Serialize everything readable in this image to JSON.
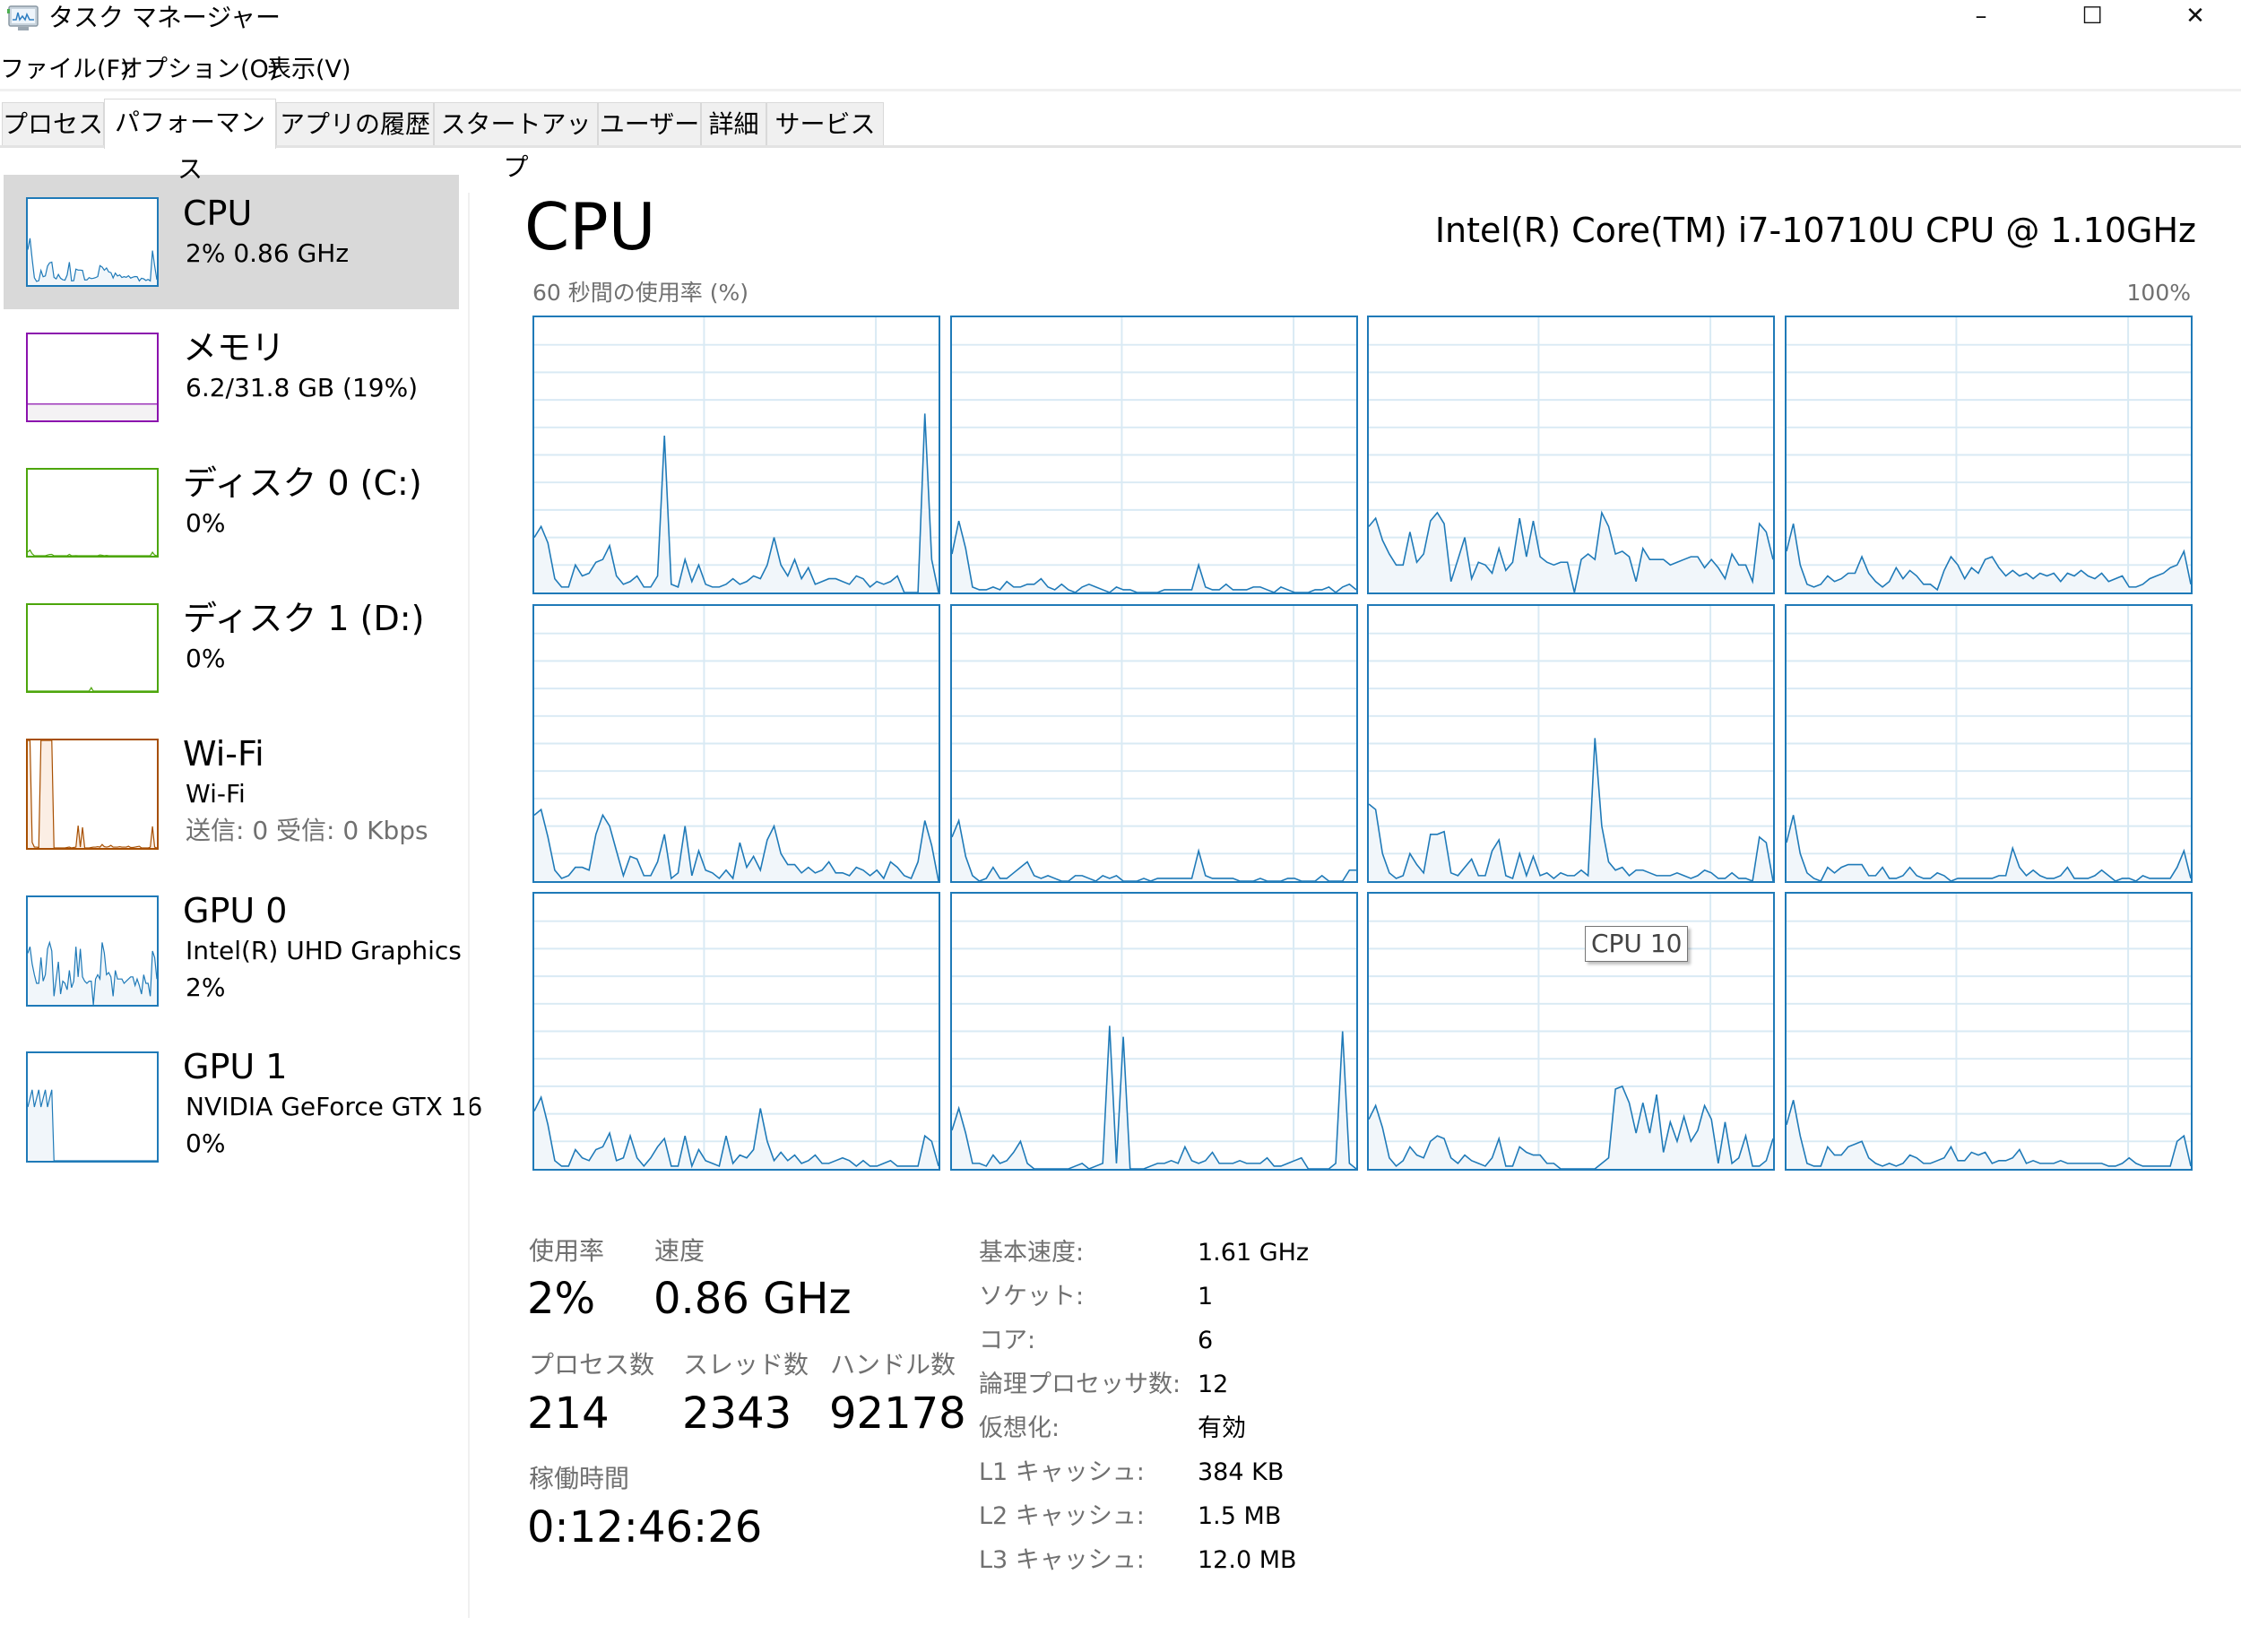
{
  "window": {
    "title": "タスク マネージャー",
    "icon": "task-manager-icon",
    "controls": {
      "minimize": "–",
      "maximize": "☐",
      "close": "✕"
    }
  },
  "menu": [
    "ファイル(F)",
    "オプション(O)",
    "表示(V)"
  ],
  "tabs": [
    {
      "label": "プロセス",
      "active": false
    },
    {
      "label": "パフォーマンス",
      "active": true
    },
    {
      "label": "アプリの履歴",
      "active": false
    },
    {
      "label": "スタートアップ",
      "active": false
    },
    {
      "label": "ユーザー",
      "active": false
    },
    {
      "label": "詳細",
      "active": false
    },
    {
      "label": "サービス",
      "active": false
    }
  ],
  "sidebar": {
    "items": [
      {
        "title": "CPU",
        "line1": "2%  0.86 GHz",
        "line2": "",
        "selected": true,
        "color": "#1f7ab8"
      },
      {
        "title": "メモリ",
        "line1": "6.2/31.8 GB (19%)",
        "line2": "",
        "selected": false,
        "color": "#8b12ae"
      },
      {
        "title": "ディスク 0 (C:)",
        "line1": "0%",
        "line2": "",
        "selected": false,
        "color": "#4da60c"
      },
      {
        "title": "ディスク 1 (D:)",
        "line1": "0%",
        "line2": "",
        "selected": false,
        "color": "#4da60c"
      },
      {
        "title": "Wi-Fi",
        "line1": "Wi-Fi",
        "line2": "送信: 0  受信: 0 Kbps",
        "selected": false,
        "color": "#a74f01"
      },
      {
        "title": "GPU 0",
        "line1": "Intel(R) UHD Graphics",
        "line2": "2%",
        "selected": false,
        "color": "#1f7ab8"
      },
      {
        "title": "GPU 1",
        "line1": "NVIDIA GeForce GTX 16",
        "line2": "0%",
        "selected": false,
        "color": "#1f7ab8"
      }
    ]
  },
  "main": {
    "title": "CPU",
    "model": "Intel(R) Core(TM) i7-10710U CPU @ 1.10GHz",
    "graph_label": "60 秒間の使用率 (%)",
    "graph_max": "100%",
    "tooltip": "CPU 10",
    "stats": {
      "usage_label": "使用率",
      "usage_value": "2%",
      "speed_label": "速度",
      "speed_value": "0.86 GHz",
      "processes_label": "プロセス数",
      "processes_value": "214",
      "threads_label": "スレッド数",
      "threads_value": "2343",
      "handles_label": "ハンドル数",
      "handles_value": "92178",
      "uptime_label": "稼働時間",
      "uptime_value": "0:12:46:26"
    },
    "info": [
      {
        "label": "基本速度:",
        "value": "1.61 GHz"
      },
      {
        "label": "ソケット:",
        "value": "1"
      },
      {
        "label": "コア:",
        "value": "6"
      },
      {
        "label": "論理プロセッサ数:",
        "value": "12"
      },
      {
        "label": "仮想化:",
        "value": "有効"
      },
      {
        "label": "L1 キャッシュ:",
        "value": "384 KB"
      },
      {
        "label": "L2 キャッシュ:",
        "value": "1.5 MB"
      },
      {
        "label": "L3 キャッシュ:",
        "value": "12.0 MB"
      }
    ]
  },
  "chart_data": {
    "type": "area",
    "title": "60 秒間の使用率 (%)",
    "ylim": [
      0,
      100
    ],
    "xlim": [
      0,
      60
    ],
    "grid": true,
    "line_color": "#1f7ab8",
    "fill_color": "#f1f6fa",
    "series": [
      {
        "name": "CPU 0",
        "values": [
          20,
          24,
          18,
          5,
          2,
          2,
          10,
          6,
          7,
          11,
          12,
          17,
          6,
          3,
          4,
          6,
          2,
          2,
          6,
          57,
          3,
          2,
          12,
          4,
          10,
          3,
          2,
          2,
          3,
          5,
          3,
          4,
          6,
          5,
          10,
          20,
          10,
          6,
          12,
          5,
          9,
          3,
          4,
          5,
          5,
          4,
          3,
          6,
          5,
          2,
          4,
          3,
          4,
          6,
          0,
          0,
          0,
          65,
          12,
          0
        ]
      },
      {
        "name": "CPU 1",
        "values": [
          14,
          26,
          16,
          2,
          1,
          1,
          2,
          1,
          4,
          2,
          2,
          3,
          3,
          5,
          2,
          1,
          3,
          1,
          0,
          2,
          3,
          2,
          1,
          0,
          2,
          1,
          1,
          0,
          0,
          0,
          0,
          1,
          1,
          1,
          1,
          1,
          10,
          2,
          1,
          1,
          3,
          1,
          1,
          1,
          2,
          2,
          1,
          0,
          2,
          1,
          0,
          0,
          0,
          1,
          1,
          2,
          0,
          2,
          3,
          1
        ]
      },
      {
        "name": "CPU 2",
        "values": [
          24,
          27,
          19,
          14,
          10,
          10,
          22,
          11,
          14,
          26,
          29,
          25,
          4,
          12,
          20,
          5,
          11,
          10,
          7,
          16,
          8,
          11,
          27,
          13,
          26,
          13,
          11,
          10,
          11,
          11,
          0,
          12,
          14,
          12,
          29,
          24,
          14,
          15,
          13,
          4,
          16,
          12,
          12,
          12,
          10,
          11,
          12,
          13,
          13,
          9,
          12,
          9,
          5,
          14,
          10,
          10,
          4,
          25,
          22,
          12
        ]
      },
      {
        "name": "CPU 3",
        "values": [
          15,
          25,
          10,
          3,
          2,
          3,
          6,
          4,
          5,
          7,
          7,
          13,
          7,
          4,
          2,
          4,
          9,
          5,
          8,
          6,
          3,
          3,
          1,
          8,
          13,
          10,
          5,
          9,
          7,
          12,
          13,
          9,
          6,
          8,
          6,
          7,
          5,
          7,
          6,
          7,
          4,
          7,
          6,
          8,
          6,
          5,
          7,
          4,
          5,
          6,
          2,
          2,
          3,
          5,
          6,
          7,
          9,
          10,
          15,
          3
        ]
      },
      {
        "name": "CPU 4",
        "values": [
          24,
          26,
          16,
          4,
          1,
          2,
          5,
          5,
          4,
          17,
          24,
          20,
          11,
          2,
          9,
          8,
          2,
          2,
          7,
          17,
          1,
          3,
          20,
          2,
          11,
          4,
          3,
          1,
          4,
          1,
          14,
          5,
          9,
          4,
          15,
          20,
          10,
          6,
          6,
          3,
          5,
          3,
          4,
          7,
          3,
          3,
          2,
          5,
          4,
          2,
          4,
          1,
          7,
          5,
          2,
          1,
          7,
          22,
          13,
          0
        ]
      },
      {
        "name": "CPU 5",
        "values": [
          16,
          22,
          9,
          2,
          0,
          1,
          5,
          1,
          1,
          3,
          5,
          7,
          2,
          1,
          2,
          1,
          0,
          0,
          2,
          2,
          1,
          0,
          2,
          1,
          2,
          0,
          0,
          0,
          1,
          0,
          1,
          1,
          1,
          1,
          1,
          1,
          11,
          2,
          1,
          1,
          1,
          1,
          0,
          0,
          0,
          1,
          0,
          0,
          0,
          1,
          1,
          0,
          0,
          0,
          2,
          0,
          0,
          0,
          4,
          4
        ]
      },
      {
        "name": "CPU 6",
        "values": [
          28,
          26,
          10,
          3,
          1,
          2,
          10,
          6,
          3,
          17,
          17,
          18,
          3,
          2,
          5,
          8,
          2,
          2,
          11,
          15,
          2,
          1,
          10,
          2,
          9,
          2,
          3,
          1,
          3,
          2,
          2,
          4,
          2,
          52,
          20,
          7,
          4,
          5,
          2,
          4,
          4,
          3,
          2,
          2,
          2,
          3,
          2,
          1,
          2,
          4,
          3,
          1,
          1,
          3,
          1,
          1,
          0,
          16,
          14,
          0
        ]
      },
      {
        "name": "CPU 7",
        "values": [
          14,
          24,
          10,
          3,
          1,
          0,
          5,
          3,
          5,
          6,
          6,
          6,
          2,
          2,
          5,
          1,
          1,
          2,
          5,
          2,
          1,
          1,
          3,
          2,
          0,
          1,
          1,
          1,
          1,
          1,
          1,
          2,
          2,
          12,
          5,
          2,
          4,
          2,
          1,
          1,
          2,
          5,
          1,
          1,
          1,
          2,
          4,
          2,
          0,
          1,
          1,
          0,
          2,
          1,
          1,
          1,
          1,
          5,
          11,
          1
        ]
      },
      {
        "name": "CPU 8",
        "values": [
          21,
          26,
          16,
          3,
          1,
          1,
          7,
          4,
          3,
          7,
          8,
          13,
          3,
          4,
          12,
          4,
          1,
          4,
          8,
          11,
          1,
          1,
          12,
          1,
          7,
          3,
          2,
          1,
          12,
          2,
          5,
          4,
          7,
          22,
          10,
          3,
          6,
          3,
          5,
          2,
          3,
          5,
          2,
          2,
          3,
          4,
          3,
          1,
          3,
          1,
          1,
          2,
          3,
          1,
          1,
          1,
          1,
          12,
          10,
          1
        ]
      },
      {
        "name": "CPU 9",
        "values": [
          14,
          22,
          13,
          2,
          2,
          1,
          5,
          2,
          3,
          6,
          10,
          2,
          0,
          0,
          0,
          0,
          0,
          0,
          1,
          2,
          0,
          1,
          2,
          52,
          2,
          48,
          0,
          0,
          0,
          1,
          2,
          2,
          3,
          2,
          8,
          3,
          2,
          3,
          6,
          2,
          2,
          2,
          3,
          2,
          2,
          2,
          4,
          1,
          1,
          2,
          3,
          4,
          0,
          0,
          0,
          0,
          2,
          50,
          2,
          0
        ]
      },
      {
        "name": "CPU 10",
        "values": [
          18,
          23,
          15,
          4,
          1,
          3,
          8,
          5,
          4,
          10,
          12,
          11,
          4,
          2,
          5,
          3,
          2,
          1,
          4,
          11,
          1,
          1,
          8,
          6,
          5,
          5,
          2,
          2,
          0,
          0,
          0,
          0,
          0,
          0,
          2,
          4,
          29,
          30,
          24,
          13,
          24,
          13,
          27,
          6,
          17,
          10,
          19,
          10,
          14,
          23,
          18,
          2,
          17,
          2,
          4,
          12,
          1,
          1,
          3,
          11
        ]
      },
      {
        "name": "CPU 11",
        "values": [
          16,
          25,
          12,
          2,
          1,
          1,
          8,
          5,
          5,
          8,
          9,
          10,
          4,
          2,
          1,
          2,
          1,
          2,
          5,
          4,
          2,
          2,
          3,
          4,
          8,
          3,
          3,
          6,
          5,
          6,
          2,
          3,
          3,
          4,
          7,
          2,
          3,
          2,
          2,
          2,
          3,
          2,
          2,
          2,
          2,
          2,
          2,
          1,
          1,
          2,
          4,
          2,
          1,
          1,
          1,
          1,
          1,
          10,
          12,
          1
        ]
      }
    ]
  }
}
